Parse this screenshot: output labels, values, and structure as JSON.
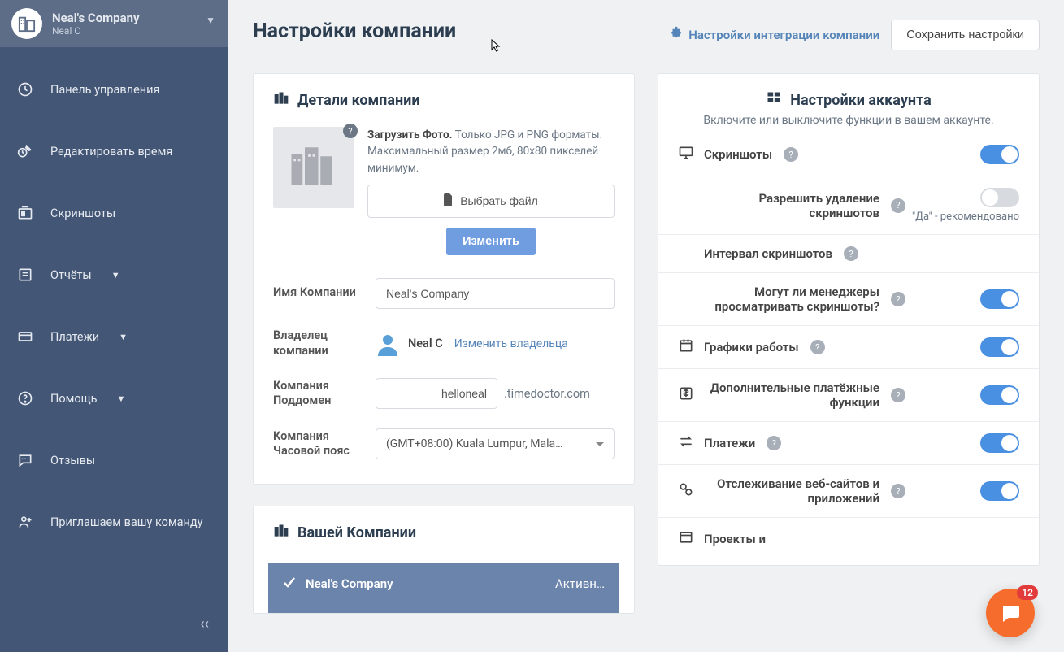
{
  "company": {
    "name": "Neal's Company",
    "user": "Neal C"
  },
  "sidebar": {
    "items": [
      {
        "label": "Панель управления"
      },
      {
        "label": "Редактировать время"
      },
      {
        "label": "Скриншоты"
      },
      {
        "label": "Отчёты"
      },
      {
        "label": "Платежи"
      },
      {
        "label": "Помощь"
      },
      {
        "label": "Отзывы"
      },
      {
        "label": "Приглашаем вашу команду"
      }
    ]
  },
  "header": {
    "title": "Настройки компании",
    "integration_link": "Настройки интеграции компании",
    "save_button": "Сохранить настройки"
  },
  "details_panel": {
    "title": "Детали компании",
    "upload_bold": "Загрузить Фото.",
    "upload_text": " Только JPG и PNG форматы. Максимальный размер 2мб, 80x80 пикселей минимум.",
    "choose_file": "Выбрать файл",
    "change_btn": "Изменить",
    "fields": {
      "name_label": "Имя Компании",
      "name_value": "Neal's Company",
      "owner_label": "Владелец компании",
      "owner_value": "Neal C",
      "change_owner": "Изменить владельца",
      "subdomain_label": "Компания Поддомен",
      "subdomain_value": "helloneal",
      "subdomain_suffix": ".timedoctor.com",
      "timezone_label": "Компания Часовой пояс",
      "timezone_value": "(GMT+08:00) Kuala Lumpur, Mala…"
    }
  },
  "your_company_panel": {
    "title": "Вашей Компании",
    "row_name": "Neal's Company",
    "row_status": "Активн…"
  },
  "account_panel": {
    "title": "Настройки аккаунта",
    "subtitle": "Включите или выключите функции в вашем аккаунте.",
    "settings": [
      {
        "label": "Скриншоты",
        "on": true,
        "icon": "monitor"
      },
      {
        "label": "Разрешить удаление скриншотов",
        "on": false,
        "note": "\"Да\" - рекомендовано"
      },
      {
        "label": "Интервал скриншотов"
      },
      {
        "label": "Могут ли менеджеры просматривать скриншоты?",
        "on": true
      },
      {
        "label": "Графики работы",
        "on": true,
        "icon": "calendar"
      },
      {
        "label": "Дополнительные платёжные функции",
        "on": true,
        "icon": "dollar"
      },
      {
        "label": "Платежи",
        "on": true,
        "icon": "exchange"
      },
      {
        "label": "Отслеживание веб-сайтов и приложений",
        "on": true,
        "icon": "track"
      },
      {
        "label": "Проекты и",
        "icon": "projects"
      }
    ]
  },
  "chat": {
    "badge": "12"
  }
}
